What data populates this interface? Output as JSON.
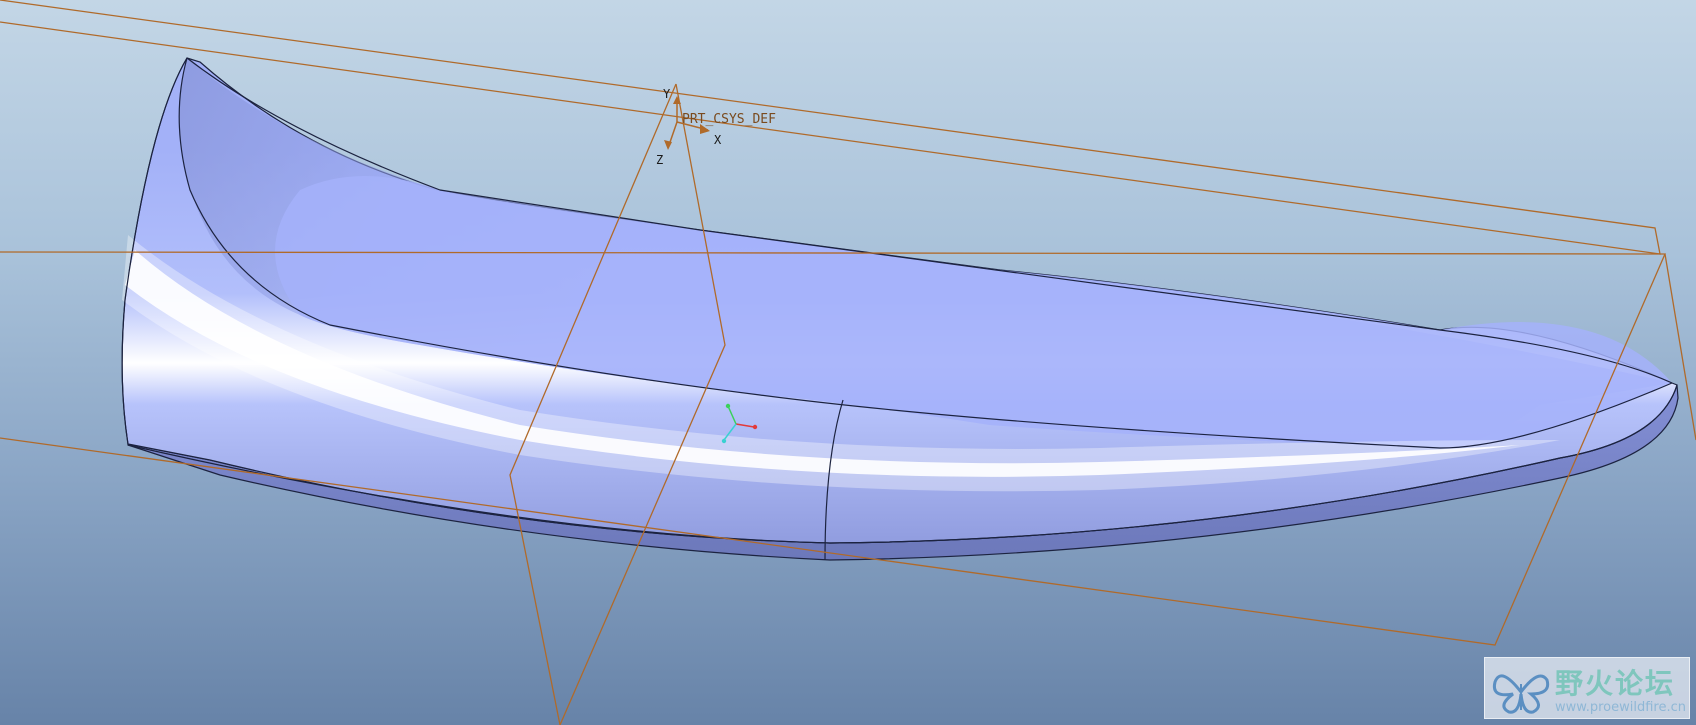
{
  "viewport": {
    "coordinate_system_label": "PRT_CSYS_DEF",
    "axis_labels": {
      "x": "X",
      "y": "Y",
      "z": "Z"
    }
  },
  "colors": {
    "background_top": "#c3d6e6",
    "background_bottom": "#6783a8",
    "surface": "#a6b2f8",
    "datum_planes": "#b06a2a",
    "edges": "#1c2340"
  },
  "watermark": {
    "title": "野火论坛",
    "url": "www.proewildfire.cn"
  }
}
